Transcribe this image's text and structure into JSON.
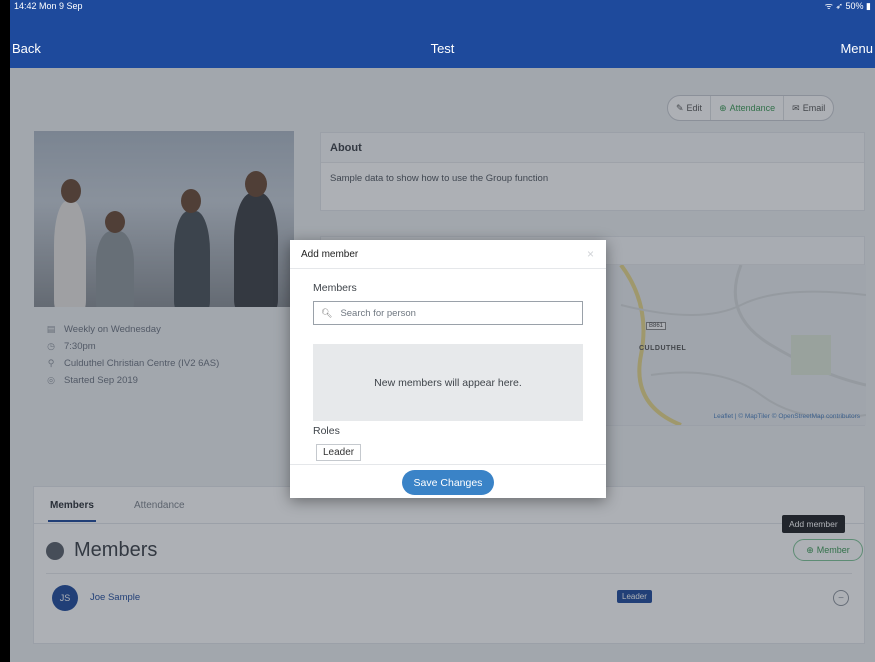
{
  "status_bar": {
    "time": "14:42  Mon 9 Sep",
    "indicators": "ᯤ ➶ 50% ▮"
  },
  "nav": {
    "back_label": "Back",
    "title": "Test",
    "menu_label": "Menu"
  },
  "actions": {
    "edit": "Edit",
    "attendance": "Attendance",
    "email": "Email"
  },
  "group": {
    "schedule": "Weekly on Wednesday",
    "time": "7:30pm",
    "location": "Culduthel Christian Centre (IV2 6AS)",
    "started": "Started Sep 2019"
  },
  "about": {
    "heading": "About",
    "text": "Sample data to show how to use the Group function"
  },
  "map": {
    "area_label": "CULDUTHEL",
    "road_badge": "B861",
    "attribution": "Leaflet | © MapTiler © OpenStreetMap contributors"
  },
  "tabs": {
    "members": "Members",
    "attendance": "Attendance"
  },
  "members_section": {
    "heading": "Members",
    "add_button": "Member",
    "tooltip": "Add member",
    "rows": [
      {
        "initials": "JS",
        "name": "Joe Sample",
        "role": "Leader"
      }
    ]
  },
  "modal": {
    "title": "Add member",
    "close": "×",
    "members_label": "Members",
    "search_placeholder": "Search for person",
    "empty_text": "New members will appear here.",
    "roles_label": "Roles",
    "role_option": "Leader",
    "save_label": "Save Changes"
  },
  "colors": {
    "brand": "#1e4a9c",
    "save_button": "#3a83c7",
    "success": "#3b9a54"
  },
  "icons": {
    "search": "search-icon",
    "close": "close-icon",
    "edit": "pencil-icon",
    "attendance": "plus-circle-icon",
    "email": "email-icon"
  }
}
